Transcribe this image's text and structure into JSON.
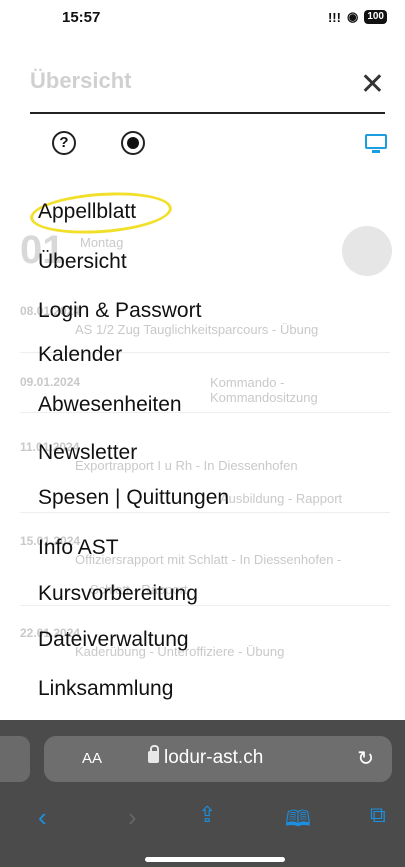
{
  "status_bar": {
    "time": "15:57",
    "signal": "!!!",
    "wifi": "◉",
    "battery": "100"
  },
  "background_page": {
    "title": "Übersicht",
    "day_number": "01",
    "day_name": "Montag",
    "entries": [
      {
        "date": "08.01.2024",
        "event": "AS 1/2 Zug Tauglichkeitsparcours - Übung"
      },
      {
        "date": "09.01.2024",
        "event": "Kommando - Kommandositzung"
      },
      {
        "date": "11.01.2024",
        "event": "Exportrapport I u Rh - In Diessenhofen"
      },
      {
        "date": "",
        "event": "Ausbildung - Rapport"
      },
      {
        "date": "15.01.2024",
        "event": "Offiziersrapport mit Schlatt - In Diessenhofen -"
      },
      {
        "date": "",
        "event": "Schlatt - Rapport"
      },
      {
        "date": "22.01.2024",
        "event": "Kaderübung - Unteroffiziere - Übung"
      }
    ]
  },
  "header": {
    "close_icon": "close-icon",
    "help_icon": "?"
  },
  "menu": {
    "items": [
      "Appellblatt",
      "Übersicht",
      "Login & Passwort",
      "Kalender",
      "Abwesenheiten",
      "Newsletter",
      "Spesen | Quittungen",
      "Info AST",
      "Kursvorbereitung",
      "Dateiverwaltung",
      "Linksammlung"
    ],
    "highlighted": "Appellblatt",
    "highlight_color": "#f2df2a"
  },
  "browser": {
    "aa_label": "AA",
    "url": "lodur-ast.ch",
    "reload_icon": "↻",
    "nav_icons": [
      "back-icon",
      "forward-icon",
      "share-icon",
      "bookmarks-icon",
      "tabs-icon"
    ],
    "accent": "#1b8fe0"
  }
}
